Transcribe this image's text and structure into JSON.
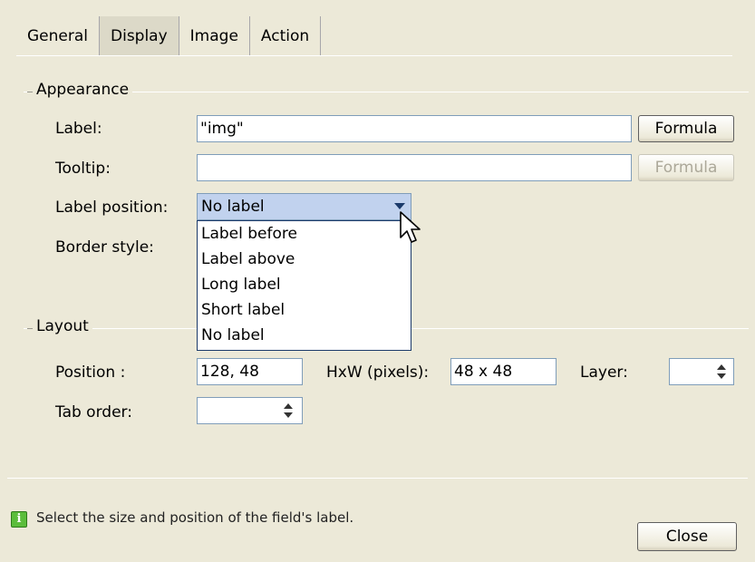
{
  "tabs": [
    "General",
    "Display",
    "Image",
    "Action"
  ],
  "active_tab": "Display",
  "appearance": {
    "legend": "Appearance",
    "label_label": "Label:",
    "label_value": "\"img\"",
    "tooltip_label": "Tooltip:",
    "tooltip_value": "",
    "formula_button": "Formula",
    "label_position_label": "Label position:",
    "label_position_value": "No label",
    "label_position_options": [
      "Label before",
      "Label above",
      "Long label",
      "Short label",
      "No label"
    ],
    "border_style_label": "Border style:"
  },
  "layout": {
    "legend": "Layout",
    "position_label": "Position :",
    "position_value": "128, 48",
    "hxw_label": "HxW (pixels):",
    "hxw_value": "48 x 48",
    "layer_label": "Layer:",
    "layer_value": "",
    "tab_order_label": "Tab order:",
    "tab_order_value": ""
  },
  "status": {
    "icon": "info-icon",
    "text": "Select the size and position of the field's label."
  },
  "close_button": "Close"
}
